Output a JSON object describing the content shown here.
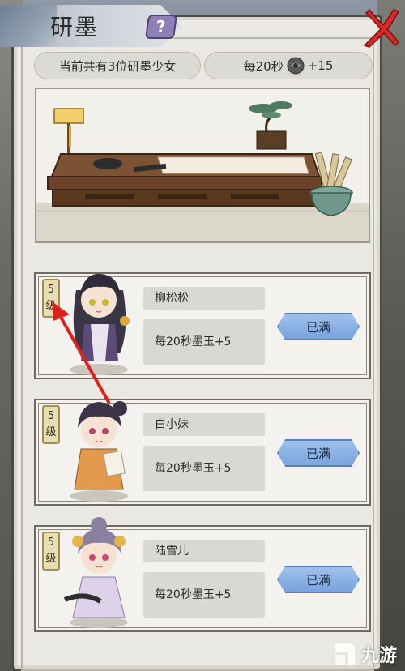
{
  "header": {
    "title": "研墨",
    "help_icon": "question-mark-icon",
    "close_icon": "red-x-close-icon"
  },
  "info": {
    "count_text": "当前共有3位研墨少女",
    "rate_prefix": "每20秒",
    "rate_suffix": "+15",
    "ink_icon": "ink-stone-icon"
  },
  "characters": [
    {
      "level_num": "5",
      "level_unit": "级",
      "name": "柳松松",
      "rate": "每20秒墨玉+5",
      "status": "已满"
    },
    {
      "level_num": "5",
      "level_unit": "级",
      "name": "白小妹",
      "rate": "每20秒墨玉+5",
      "status": "已满"
    },
    {
      "level_num": "5",
      "level_unit": "级",
      "name": "陆雪儿",
      "rate": "每20秒墨玉+5",
      "status": "已满"
    }
  ],
  "watermark": {
    "text": "九游"
  },
  "colors": {
    "accent_button": "#7aa4dd",
    "panel": "#eae8e2",
    "annotation_arrow": "#e02020"
  }
}
